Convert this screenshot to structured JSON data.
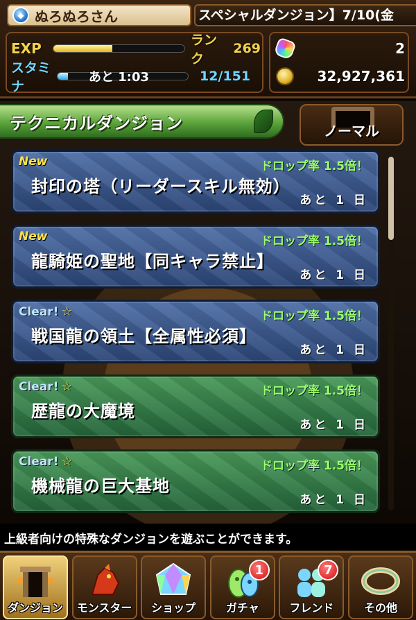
{
  "header": {
    "user_name": "ぬろぬろさん",
    "news_ticker": "スペシャルダンジョン】7/10(金",
    "exp_label": "EXP",
    "exp_progress": 0.45,
    "rank_label": "ランク",
    "rank_value": "269",
    "stamina_label": "スタミナ",
    "stamina_progress": 0.08,
    "stamina_timer": "あと 1:03",
    "stamina_value": "12/151",
    "magic_stones": "2",
    "coins": "32,927,361"
  },
  "section": {
    "title": "テクニカルダンジョン",
    "mode_label": "ノーマル"
  },
  "dungeons": [
    {
      "badge": "New",
      "badge_type": "new",
      "drop_rate": "ドロップ率 1.5倍！",
      "name": "封印の塔（リーダースキル無効）",
      "days_left": "あと 1 日",
      "color": "blue"
    },
    {
      "badge": "New",
      "badge_type": "new",
      "drop_rate": "ドロップ率 1.5倍！",
      "name": "龍騎姫の聖地【同キャラ禁止】",
      "days_left": "あと 1 日",
      "color": "blue"
    },
    {
      "badge": "Clear!",
      "badge_type": "clear",
      "drop_rate": "ドロップ率 1.5倍！",
      "name": "戦国龍の領土【全属性必須】",
      "days_left": "あと 1 日",
      "color": "blue"
    },
    {
      "badge": "Clear!",
      "badge_type": "clear",
      "drop_rate": "ドロップ率 1.5倍！",
      "name": "歴龍の大魔境",
      "days_left": "あと 1 日",
      "color": "green"
    },
    {
      "badge": "Clear!",
      "badge_type": "clear",
      "drop_rate": "ドロップ率 1.5倍！",
      "name": "機械龍の巨大基地",
      "days_left": "あと 1 日",
      "color": "green"
    }
  ],
  "hint_text": "上級者向けの特殊なダンジョンを遊ぶことができます。",
  "nav": [
    {
      "label": "ダンジョン",
      "icon": "gate-icon",
      "badge": ""
    },
    {
      "label": "モンスター",
      "icon": "dragon-icon",
      "badge": ""
    },
    {
      "label": "ショップ",
      "icon": "gem-icon",
      "badge": ""
    },
    {
      "label": "ガチャ",
      "icon": "egg-icon",
      "badge": "1"
    },
    {
      "label": "フレンド",
      "icon": "friends-icon",
      "badge": "7"
    },
    {
      "label": "その他",
      "icon": "ring-icon",
      "badge": ""
    }
  ]
}
